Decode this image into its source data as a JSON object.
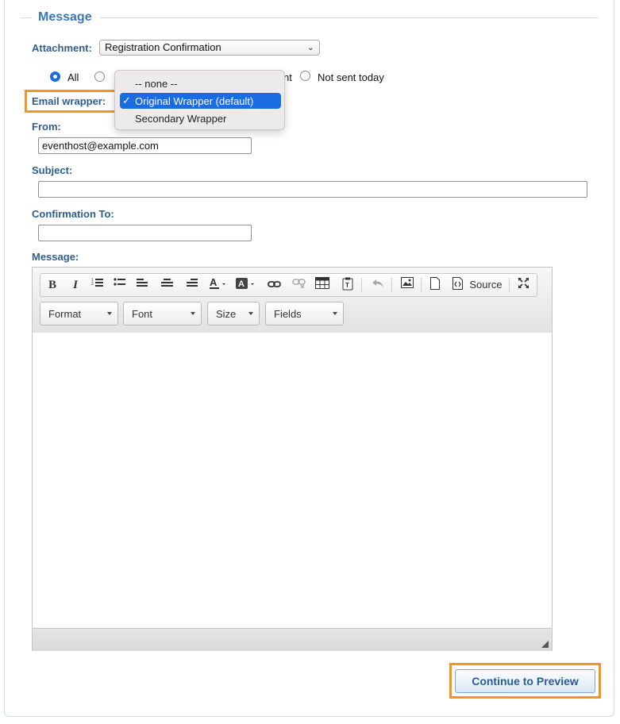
{
  "section": {
    "legend": "Message"
  },
  "attachment": {
    "label": "Attachment:",
    "value": "Registration Confirmation"
  },
  "recipients": {
    "options": [
      {
        "label": "All",
        "selected": true
      },
      {
        "label": "",
        "selected": false
      },
      {
        "label": "nt",
        "selected": false
      },
      {
        "label": "Not sent today",
        "selected": false
      }
    ]
  },
  "email_wrapper": {
    "label": "Email wrapper:",
    "dropdown_open": true,
    "options": [
      "-- none --",
      "Original Wrapper (default)",
      "Secondary Wrapper"
    ],
    "selected": "Original Wrapper (default)",
    "checkmark": "✓"
  },
  "from": {
    "label": "From:",
    "value": "eventhost@example.com"
  },
  "subject": {
    "label": "Subject:",
    "value": ""
  },
  "confirmation_to": {
    "label": "Confirmation To:",
    "value": ""
  },
  "message": {
    "label": "Message:"
  },
  "editor": {
    "toolbar_icons": [
      "bold-icon",
      "italic-icon",
      "numbered-list-icon",
      "bulleted-list-icon",
      "align-left-icon",
      "align-center-icon",
      "align-right-icon",
      "text-color-icon",
      "background-color-icon",
      "link-icon",
      "unlink-icon",
      "table-icon",
      "paste-text-icon",
      "undo-icon",
      "image-icon",
      "new-page-icon",
      "source-icon",
      "maximize-icon"
    ],
    "bold": "B",
    "italic": "I",
    "source_label": "Source",
    "combos": {
      "format": "Format",
      "font": "Font",
      "size": "Size",
      "fields": "Fields"
    },
    "content": ""
  },
  "continue_button": "Continue to Preview",
  "colors": {
    "highlight": "#f5951f",
    "accent": "#3a78b5",
    "label": "#2e5d8f",
    "selection": "#1a6de0"
  }
}
